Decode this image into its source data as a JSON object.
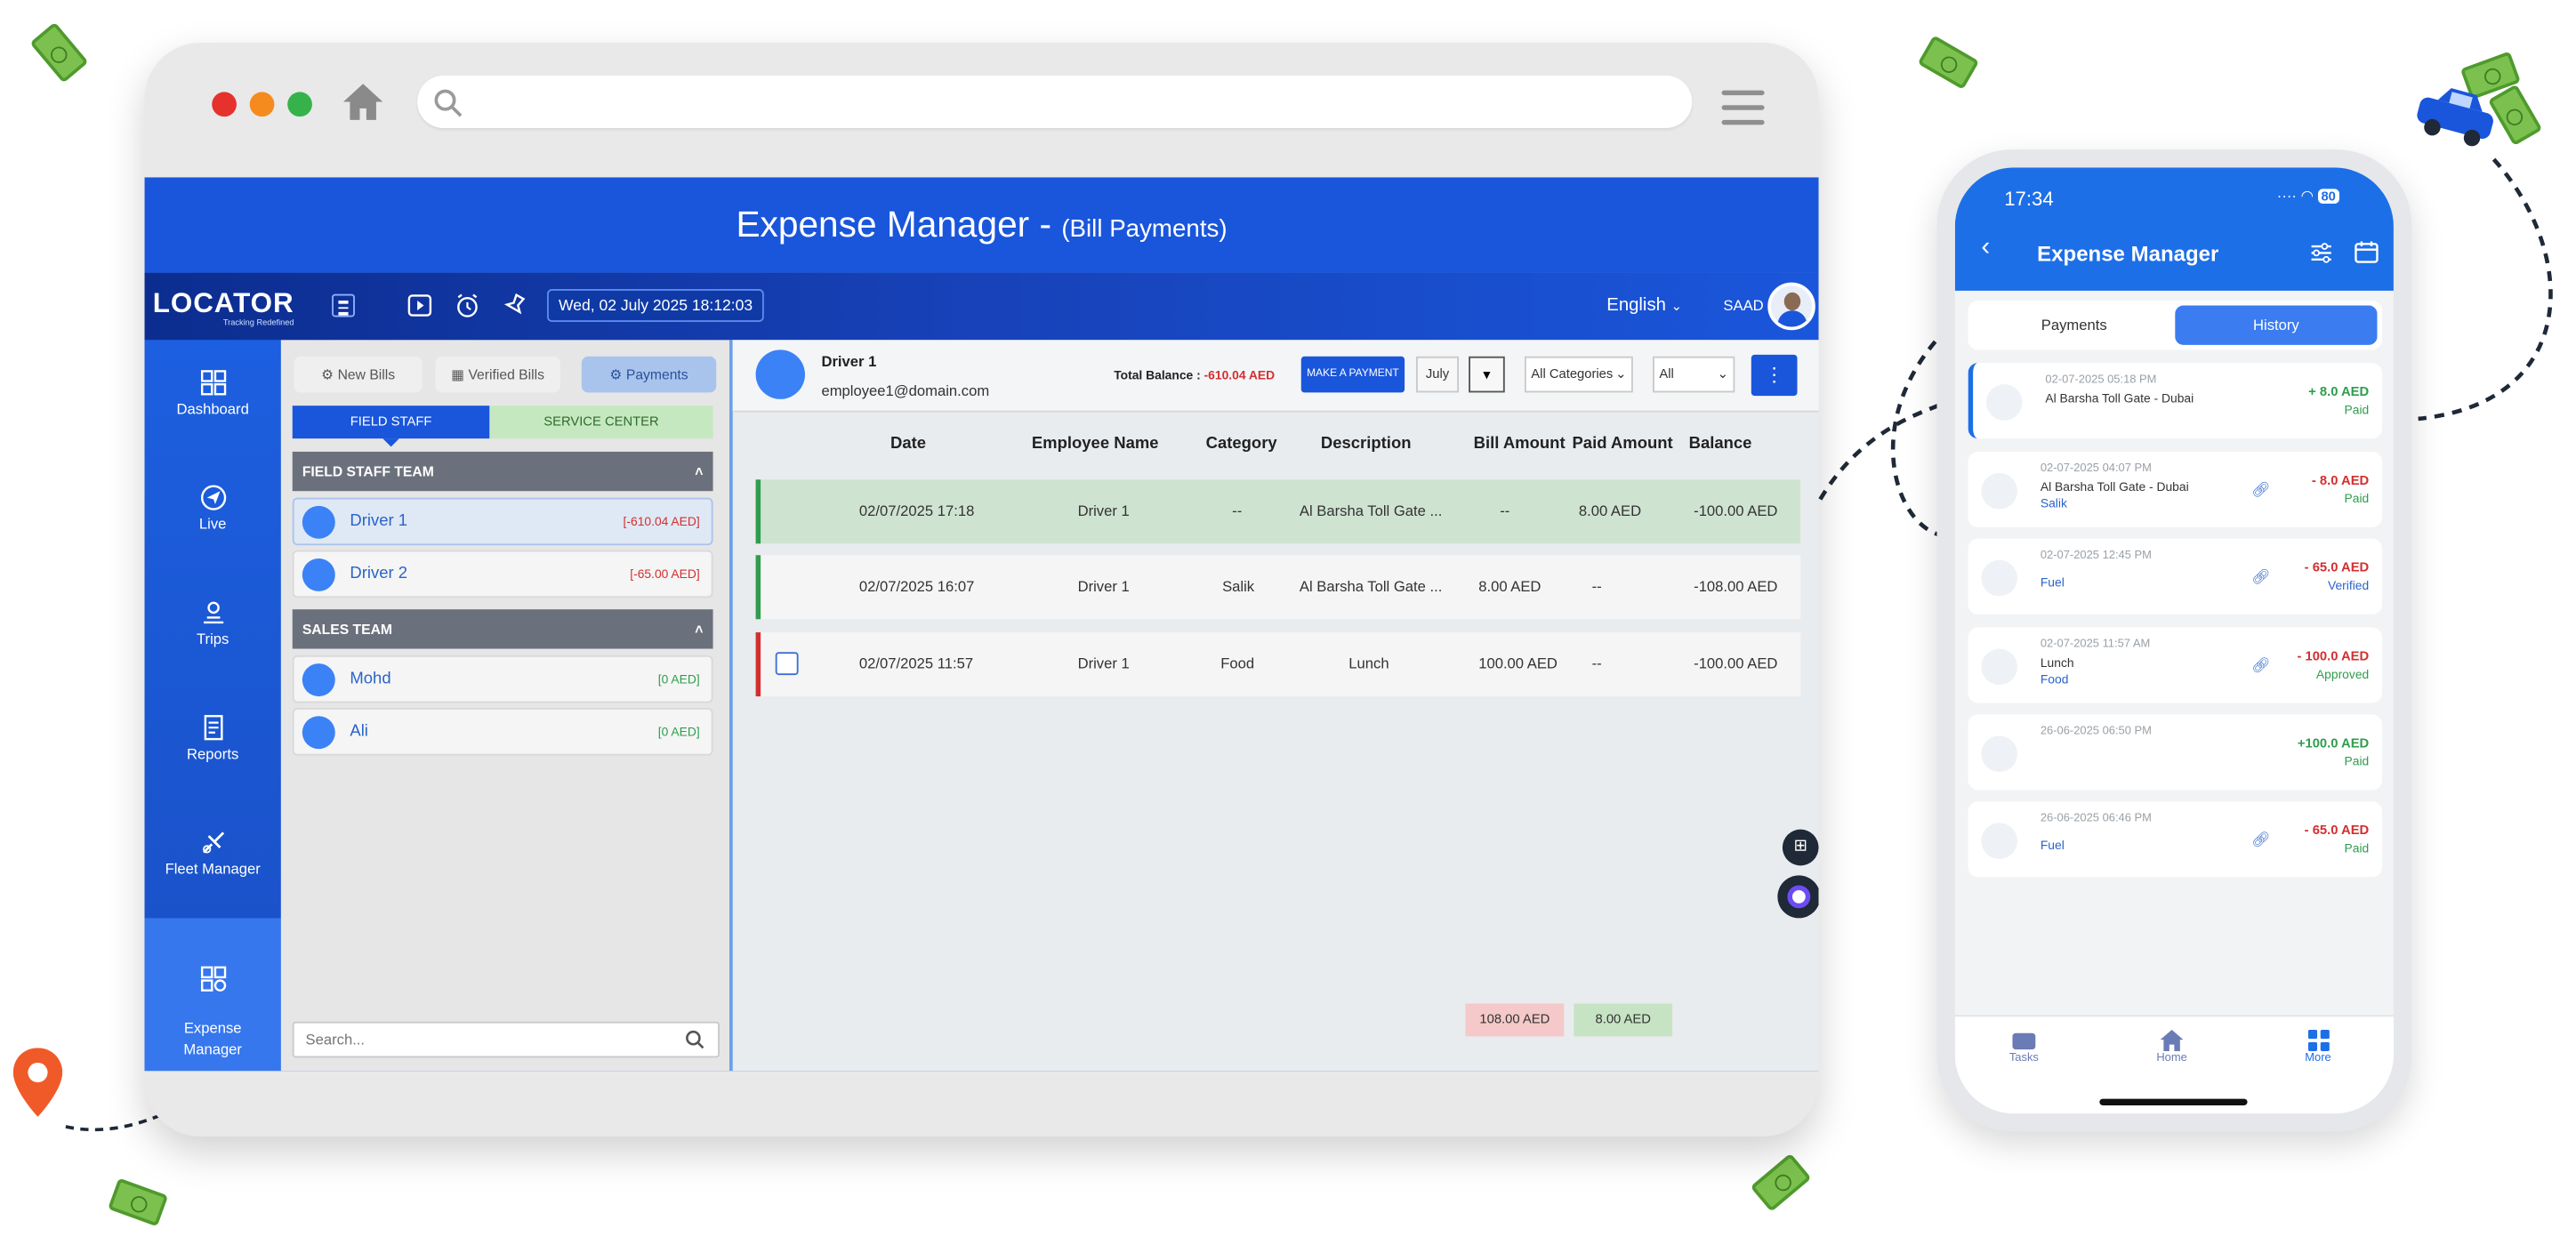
{
  "browser": {
    "title_main": "Expense Manager - ",
    "title_sub": "(Bill Payments)"
  },
  "topbar": {
    "logo_text": "LOCATOR",
    "logo_tagline": "Tracking Redefined",
    "datetime": "Wed, 02 July 2025 18:12:03",
    "language": "English",
    "user": "SAAD"
  },
  "sidebar": {
    "items": [
      {
        "label": "Dashboard",
        "icon": "dashboard-icon"
      },
      {
        "label": "Live",
        "icon": "navigation-icon"
      },
      {
        "label": "Trips",
        "icon": "route-icon"
      },
      {
        "label": "Reports",
        "icon": "report-icon"
      },
      {
        "label": "Fleet Manager",
        "icon": "fleet-icon"
      },
      {
        "label": "Expense\nManager",
        "icon": "expense-icon"
      }
    ]
  },
  "left": {
    "tabs": [
      "New Bills",
      "Verified Bills",
      "Payments"
    ],
    "segments": [
      "FIELD STAFF",
      "SERVICE CENTER"
    ],
    "teams": [
      {
        "name": "FIELD STAFF TEAM",
        "members": [
          {
            "name": "Driver 1",
            "amount": "[-610.04 AED]",
            "color": "#d32f2f"
          },
          {
            "name": "Driver 2",
            "amount": "[-65.00 AED]",
            "color": "#d32f2f"
          }
        ]
      },
      {
        "name": "SALES TEAM",
        "members": [
          {
            "name": "Mohd",
            "amount": "[0 AED]",
            "color": "#2e9d4d"
          },
          {
            "name": "Ali",
            "amount": "[0 AED]",
            "color": "#2e9d4d"
          }
        ]
      }
    ],
    "search_placeholder": "Search..."
  },
  "main": {
    "employee_name": "Driver 1",
    "employee_email": "employee1@domain.com",
    "balance_label": "Total Balance : ",
    "balance_value": "-610.04 AED",
    "make_payment": "MAKE A PAYMENT",
    "month": "July",
    "category_filter": "All Categories",
    "status_filter": "All",
    "columns": [
      "Date",
      "Employee Name",
      "Category",
      "Description",
      "Bill Amount",
      "Paid Amount",
      "Balance"
    ],
    "rows": [
      {
        "date": "02/07/2025 17:18",
        "employee": "Driver 1",
        "category": "--",
        "description": "Al Barsha Toll Gate ...",
        "bill": "--",
        "paid": "8.00 AED",
        "balance": "-100.00 AED"
      },
      {
        "date": "02/07/2025 16:07",
        "employee": "Driver 1",
        "category": "Salik",
        "description": "Al Barsha Toll Gate ...",
        "bill": "8.00 AED",
        "paid": "--",
        "balance": "-108.00 AED"
      },
      {
        "date": "02/07/2025 11:57",
        "employee": "Driver 1",
        "category": "Food",
        "description": "Lunch",
        "bill": "100.00 AED",
        "paid": "--",
        "balance": "-100.00 AED"
      }
    ],
    "total_bill": "108.00 AED",
    "total_paid": "8.00 AED"
  },
  "phone": {
    "time": "17:34",
    "battery": "80",
    "title": "Expense Manager",
    "tabs": [
      "Payments",
      "History"
    ],
    "history": [
      {
        "date": "02-07-2025 05:18 PM",
        "title": "Al Barsha Toll Gate - Dubai",
        "tag": "",
        "amount": "+ 8.0 AED",
        "status": "Paid",
        "link": false
      },
      {
        "date": "02-07-2025 04:07 PM",
        "title": "Al Barsha Toll Gate - Dubai",
        "tag": "Salik",
        "amount": "- 8.0 AED",
        "status": "Paid",
        "link": true
      },
      {
        "date": "02-07-2025 12:45 PM",
        "title": "",
        "tag": "Fuel",
        "amount": "- 65.0 AED",
        "status": "Verified",
        "link": true
      },
      {
        "date": "02-07-2025 11:57 AM",
        "title": "Lunch",
        "tag": "Food",
        "amount": "- 100.0 AED",
        "status": "Approved",
        "link": true
      },
      {
        "date": "26-06-2025 06:50 PM",
        "title": "",
        "tag": "",
        "amount": "+100.0 AED",
        "status": "Paid",
        "link": false
      },
      {
        "date": "26-06-2025 06:46 PM",
        "title": "",
        "tag": "Fuel",
        "amount": "- 65.0 AED",
        "status": "Paid",
        "link": true
      }
    ],
    "nav": [
      "Tasks",
      "Home",
      "More"
    ]
  },
  "colors": {
    "primary": "#1a56db",
    "positive": "#2e9d4d",
    "negative": "#d32f2f",
    "verified": "#2a64c9"
  }
}
